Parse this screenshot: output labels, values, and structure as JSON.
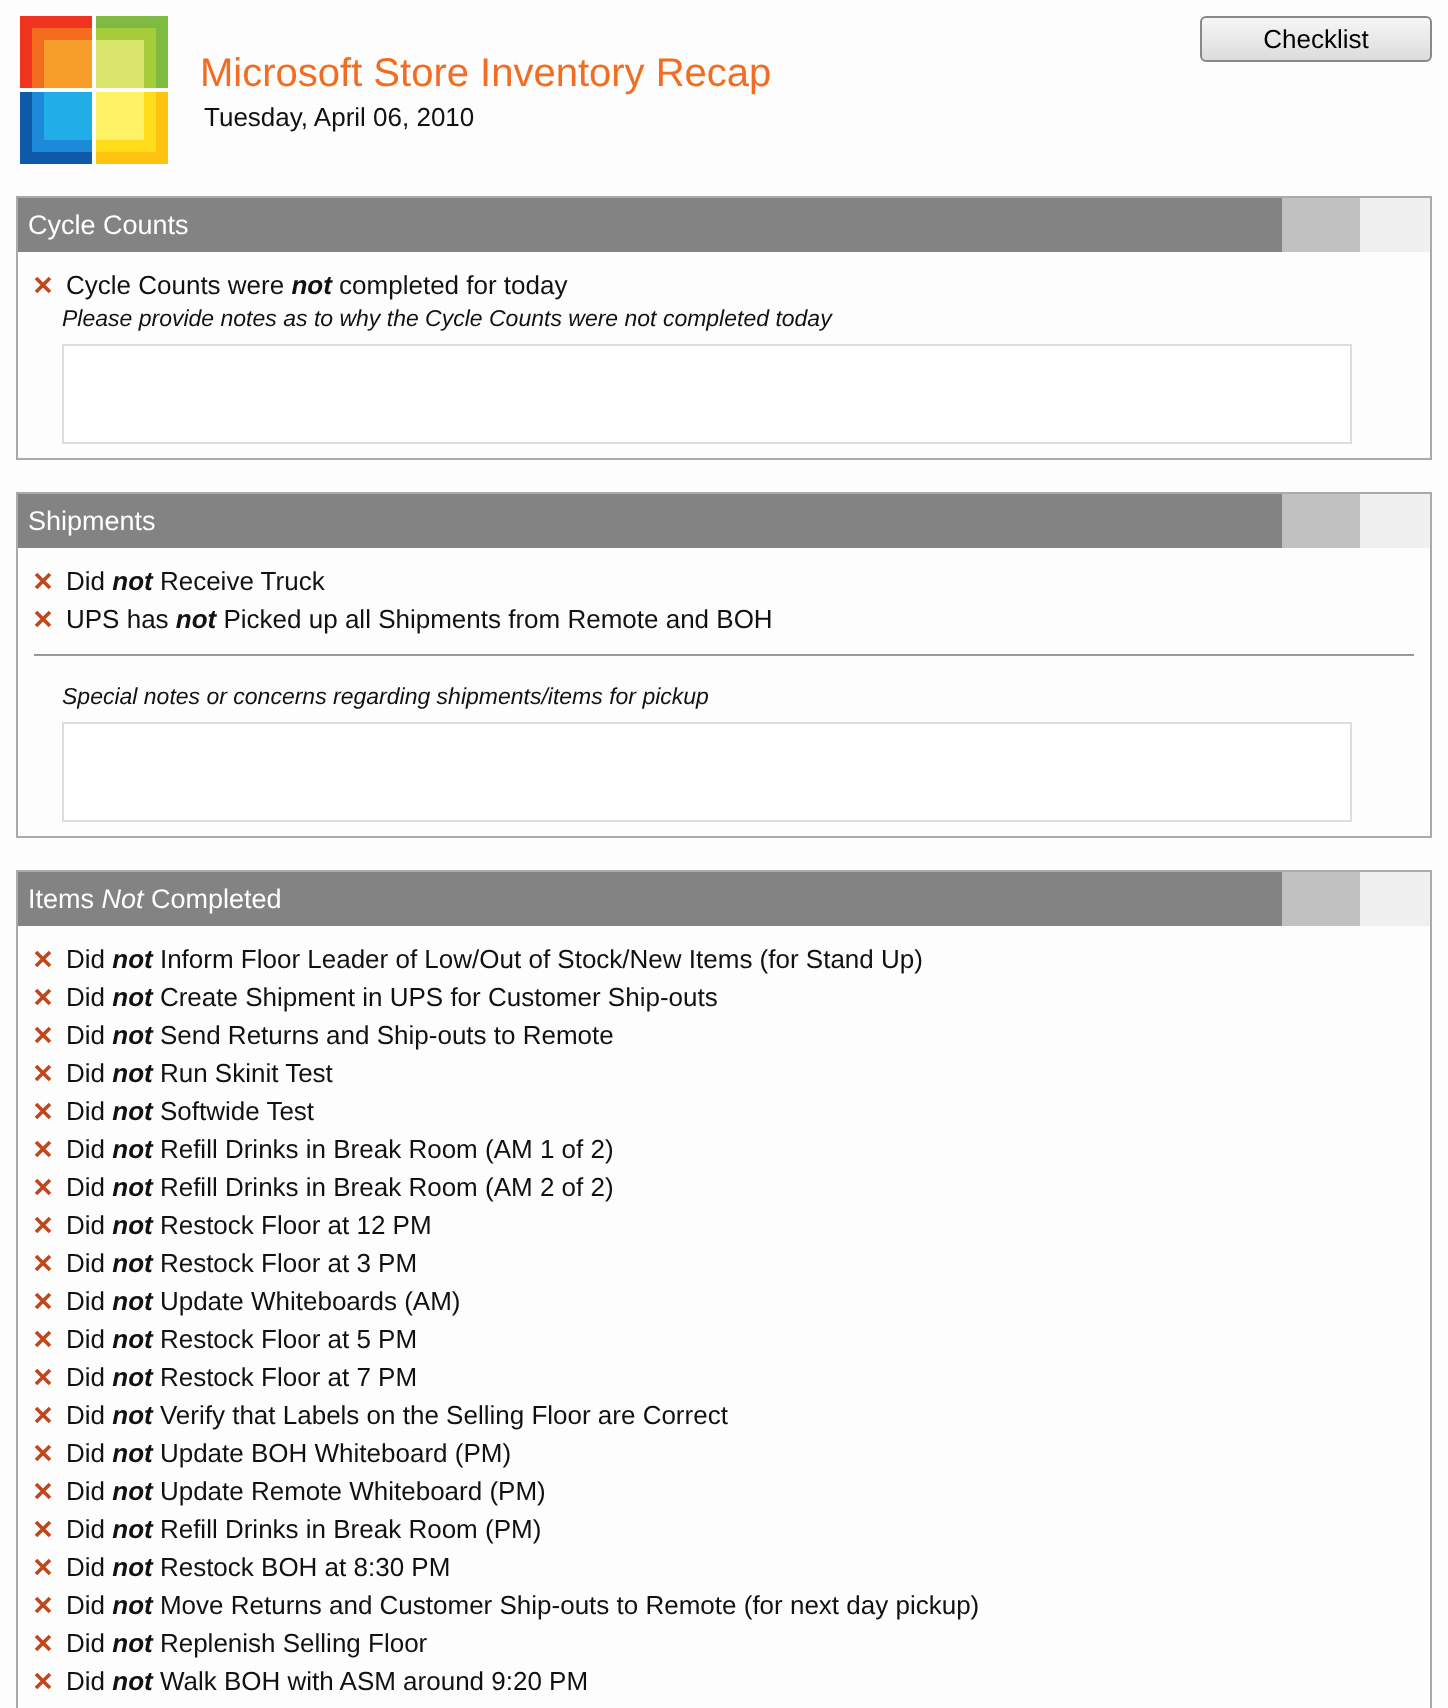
{
  "header": {
    "title": "Microsoft Store Inventory Recap",
    "date": "Tuesday, April 06, 2010"
  },
  "checklist_button": "Checklist",
  "sections": [
    {
      "title": "Cycle Counts",
      "items": [
        "Cycle Counts were **not** completed for today"
      ],
      "notes": {
        "label": "Please provide notes as to why the Cycle Counts were not completed today",
        "divided": false
      }
    },
    {
      "title": "Shipments",
      "items": [
        "Did **not** Receive Truck",
        "UPS has **not** Picked up all Shipments from Remote and BOH"
      ],
      "notes": {
        "label": "Special notes or concerns regarding shipments/items for pickup",
        "divided": true
      }
    },
    {
      "title": "Items *Not* Completed",
      "items": [
        "Did **not** Inform Floor Leader of Low/Out of Stock/New Items (for Stand Up)",
        "Did **not** Create Shipment in UPS for Customer Ship-outs",
        "Did **not** Send Returns and Ship-outs to Remote",
        "Did **not** Run Skinit Test",
        "Did **not** Softwide Test",
        "Did **not** Refill Drinks in Break Room (AM 1 of 2)",
        "Did **not** Refill Drinks in Break Room (AM 2 of 2)",
        "Did **not** Restock Floor at 12 PM",
        "Did **not** Restock Floor at 3 PM",
        "Did **not** Update Whiteboards (AM)",
        "Did **not** Restock Floor at 5 PM",
        "Did **not** Restock Floor at 7 PM",
        "Did **not** Verify that Labels on the Selling Floor are Correct",
        "Did **not** Update BOH Whiteboard (PM)",
        "Did **not** Update Remote Whiteboard (PM)",
        "Did **not** Refill Drinks in Break Room (PM)",
        "Did **not** Restock BOH at 8:30 PM",
        "Did **not** Move Returns and Customer Ship-outs to Remote (for next day pickup)",
        "Did **not** Replenish Selling Floor",
        "Did **not** Walk BOH with ASM around 9:20 PM"
      ]
    }
  ]
}
